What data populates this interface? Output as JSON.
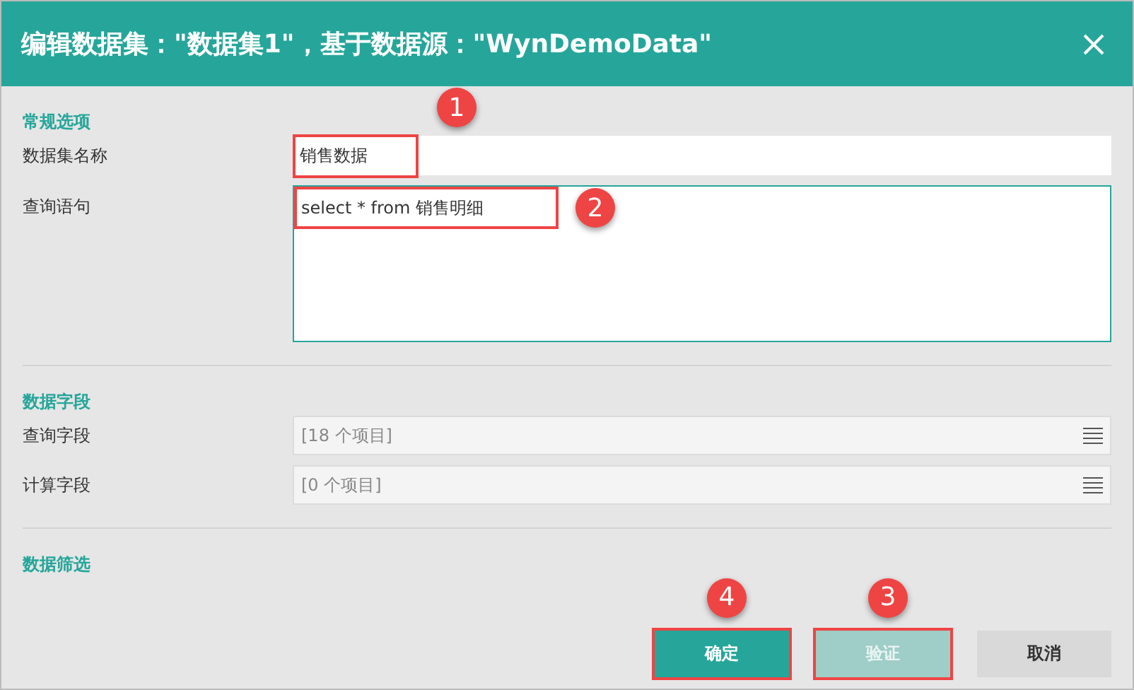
{
  "window": {
    "title": "编辑数据集：\"数据集1\"，基于数据源：\"WynDemoData\""
  },
  "sections": [
    {
      "title": "常规选项",
      "rows": [
        {
          "kind": "text",
          "label": "数据集名称",
          "value": "销售数据",
          "highlighted": true,
          "callout": "1"
        },
        {
          "kind": "query",
          "label": "查询语句",
          "value": "select * from 销售明细",
          "highlighted": true,
          "callout": "2"
        }
      ]
    },
    {
      "title": "数据字段",
      "rows": [
        {
          "kind": "list",
          "label": "查询字段",
          "value": "[18 个项目]",
          "highlighted": false
        },
        {
          "kind": "list",
          "label": "计算字段",
          "value": "[0 个项目]",
          "highlighted": false
        }
      ]
    },
    {
      "title": "数据筛选"
    }
  ],
  "buttons": [
    {
      "label": "确定",
      "kind": "primary",
      "disabled": false,
      "highlighted": true,
      "callout": "4"
    },
    {
      "label": "验证",
      "kind": "primary",
      "disabled": true,
      "highlighted": true,
      "callout": "3"
    },
    {
      "label": "取消",
      "kind": "secondary",
      "highlighted": false
    }
  ]
}
